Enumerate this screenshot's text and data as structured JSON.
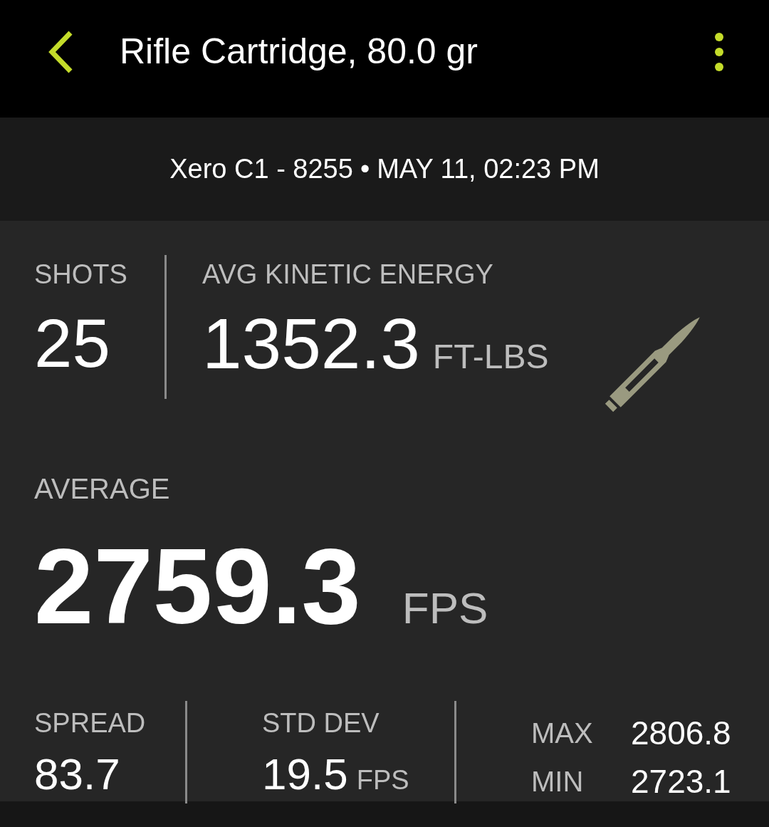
{
  "app_bar": {
    "title": "Rifle Cartridge, 80.0 gr"
  },
  "session": {
    "device": "Xero C1 - 8255",
    "separator": "•",
    "date": "MAY 11, 02:23 PM"
  },
  "shots": {
    "label": "SHOTS",
    "value": "25"
  },
  "energy": {
    "label": "AVG KINETIC ENERGY",
    "value": "1352.3",
    "unit": "FT-LBS"
  },
  "average": {
    "label": "AVERAGE",
    "value": "2759.3",
    "unit": "FPS"
  },
  "spread": {
    "label": "SPREAD",
    "value": "83.7"
  },
  "std_dev": {
    "label": "STD DEV",
    "value": "19.5",
    "unit": "FPS"
  },
  "extremes": [
    {
      "label": "MAX",
      "value": "2806.8"
    },
    {
      "label": "MIN",
      "value": "2723.1"
    }
  ]
}
